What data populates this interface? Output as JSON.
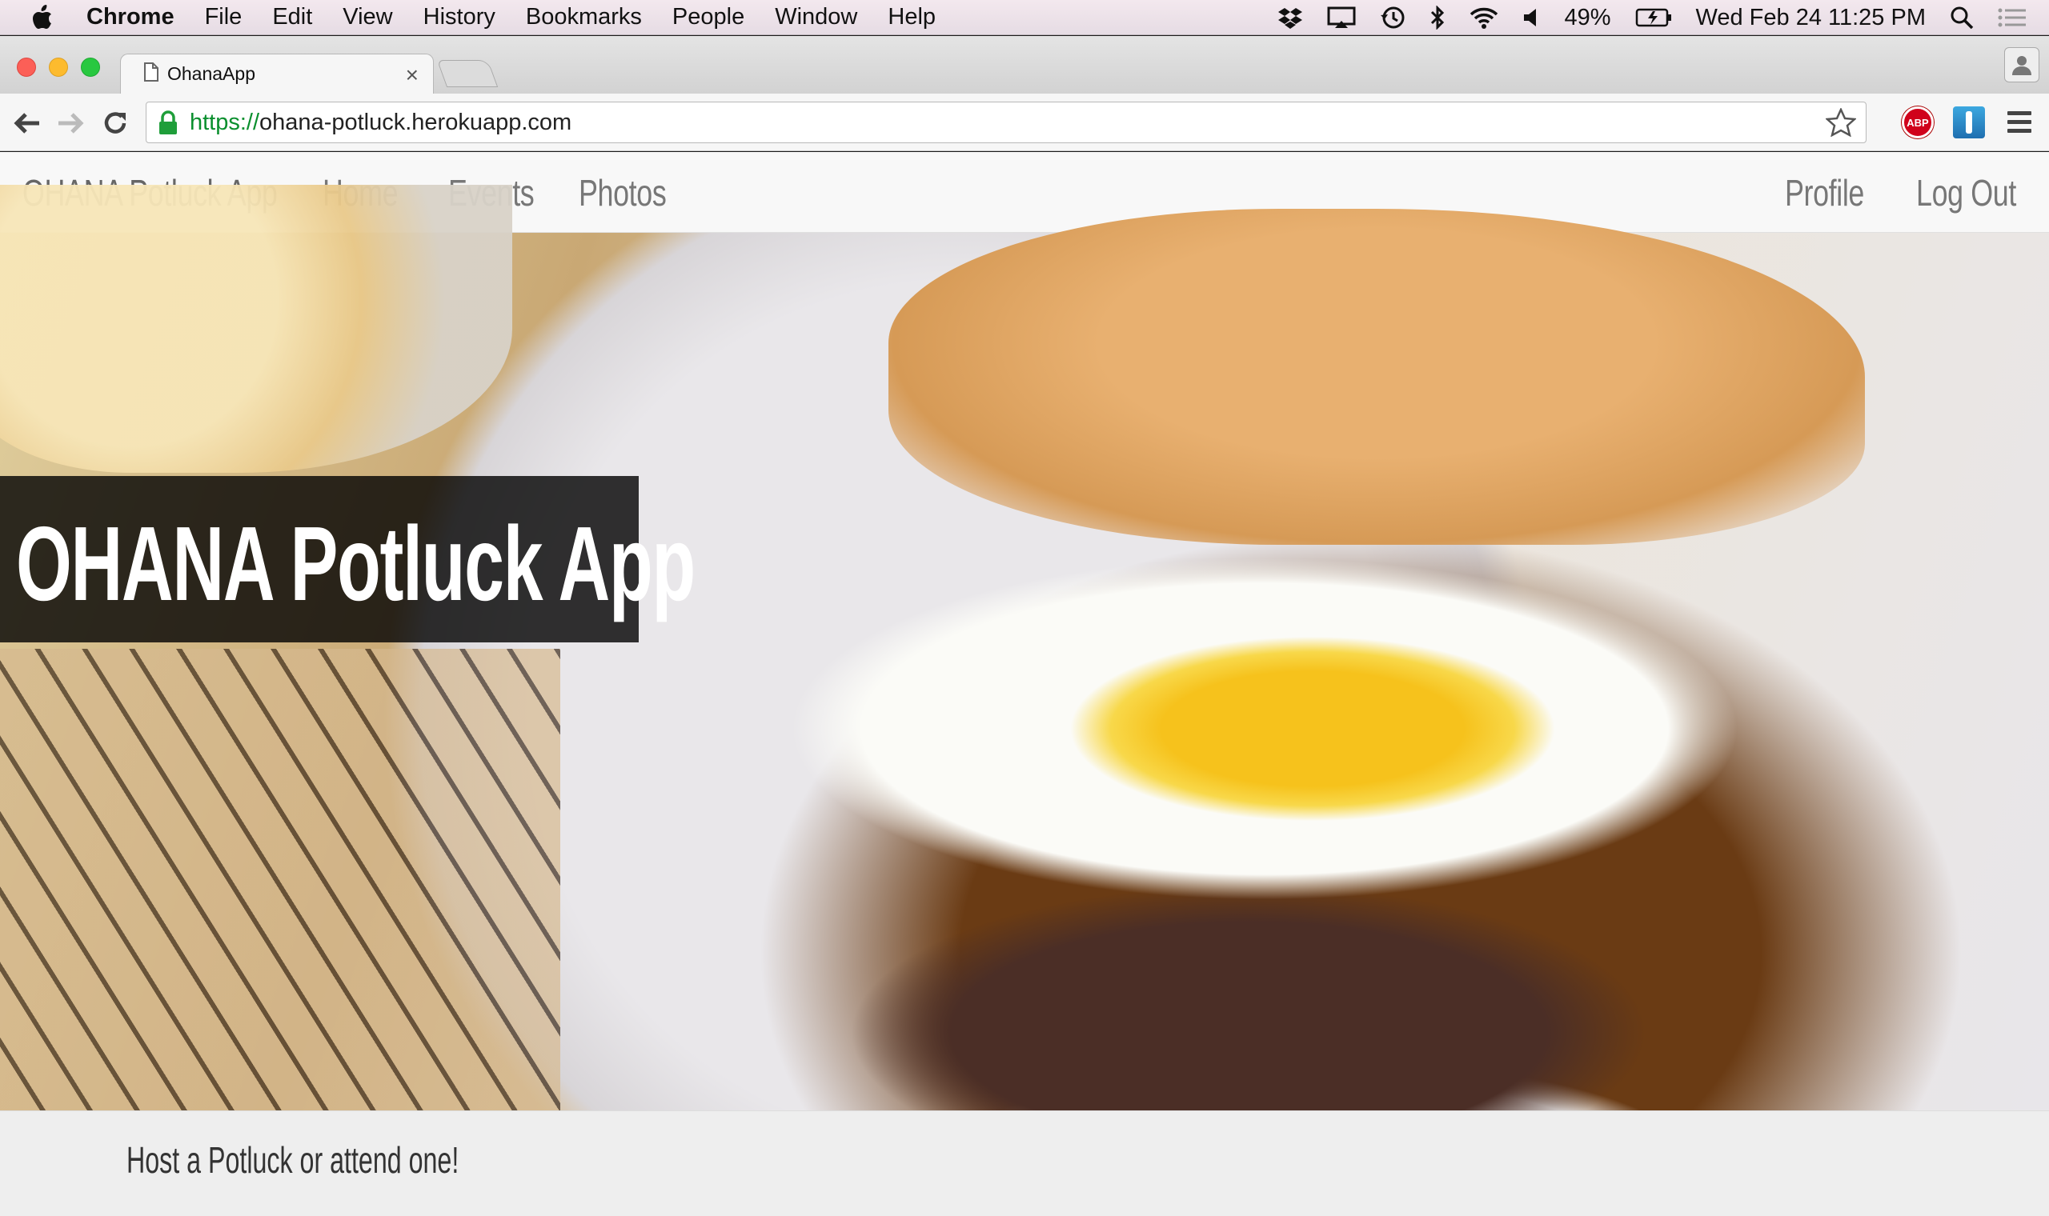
{
  "menubar": {
    "app_name": "Chrome",
    "items": [
      "File",
      "Edit",
      "View",
      "History",
      "Bookmarks",
      "People",
      "Window",
      "Help"
    ],
    "battery": "49%",
    "datetime": "Wed Feb 24  11:25 PM"
  },
  "browser": {
    "tab_title": "OhanaApp",
    "tab_close": "×",
    "url_scheme": "https://",
    "url_rest": "ohana-potluck.herokuapp.com",
    "abp_label": "ABP"
  },
  "site": {
    "brand": "OHANA Potluck App",
    "nav_left": [
      "Home",
      "Events",
      "Photos"
    ],
    "nav_right": [
      "Profile",
      "Log Out"
    ],
    "hero_title": "OHANA Potluck App",
    "tagline": "Host a Potluck or attend one!"
  },
  "colors": {
    "close": "#fc5f57",
    "minimize": "#fdbb2e",
    "zoom": "#28c840",
    "secure_scheme": "#0a8f2e",
    "hero_overlay": "rgba(0,0,0,0.8)"
  }
}
